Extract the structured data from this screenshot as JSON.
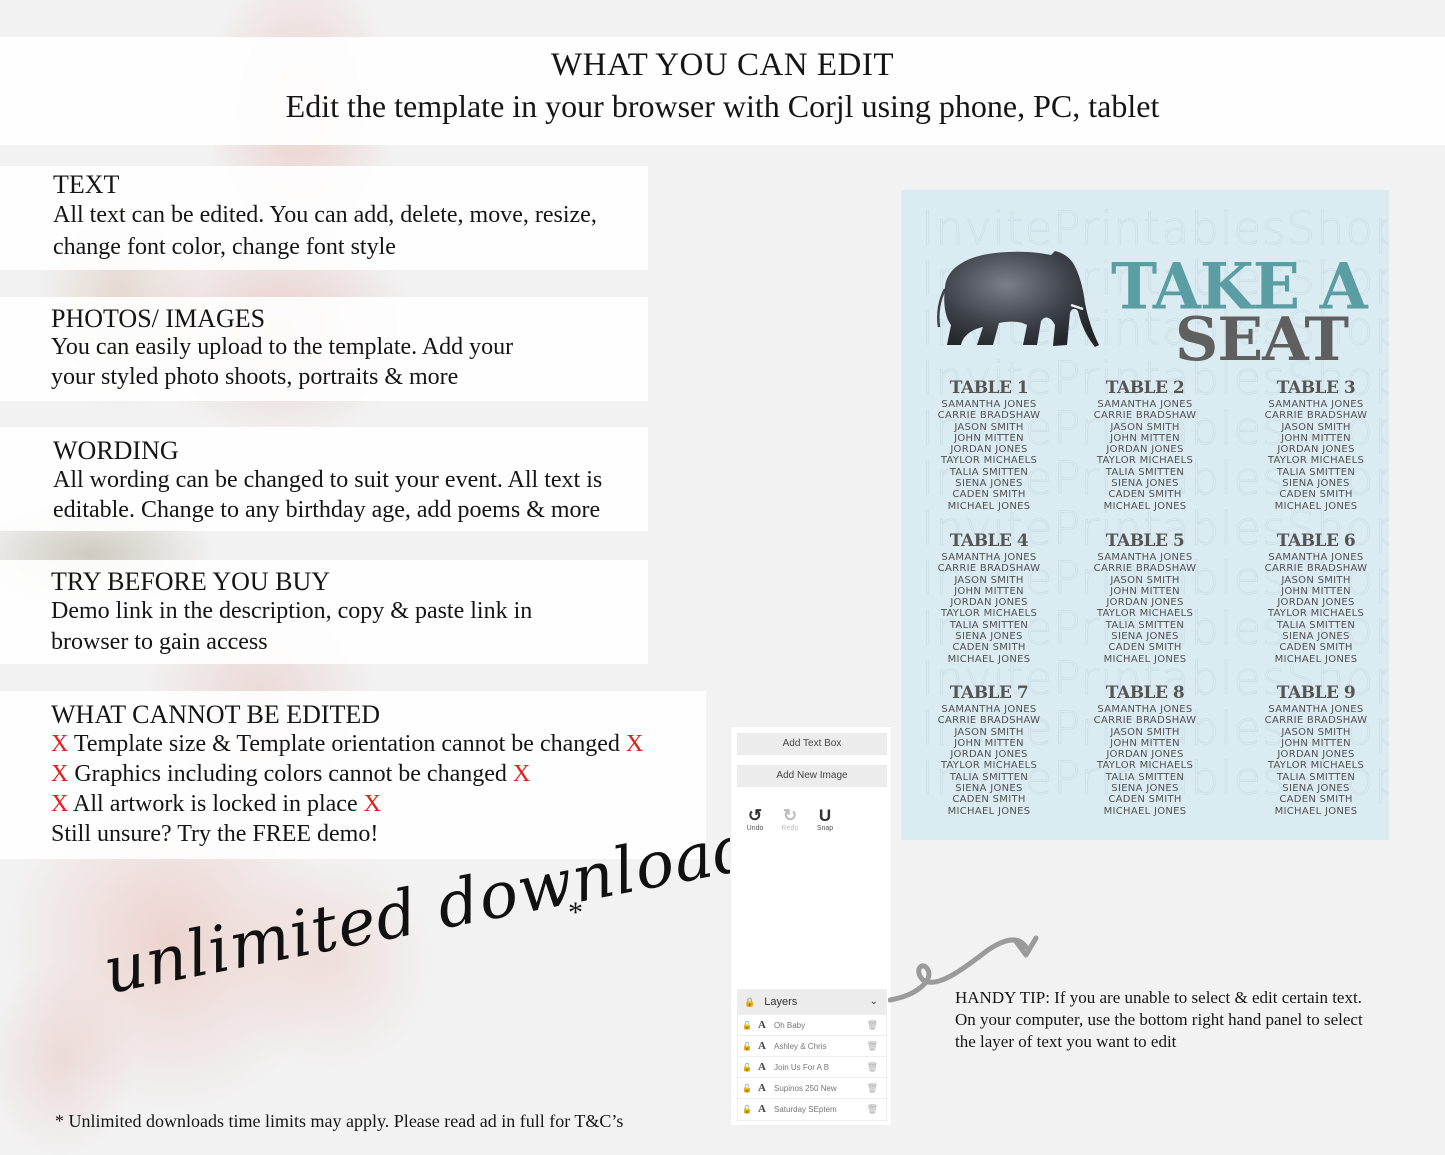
{
  "header": {
    "title": "WHAT YOU CAN EDIT",
    "subtitle": "Edit the template in your browser with Corjl using phone, PC, tablet"
  },
  "sections": {
    "text": {
      "title": "TEXT",
      "lines": [
        "All text can be edited. You can add, delete, move, resize,",
        "change font color, change font style"
      ]
    },
    "photos": {
      "title": "PHOTOS/ IMAGES",
      "lines": [
        "You can easily upload to the template. Add your",
        "your styled photo shoots, portraits & more"
      ]
    },
    "wording": {
      "title": "WORDING",
      "lines": [
        "All wording can be changed to suit your event. All text is",
        "editable. Change to any birthday age, add poems & more"
      ]
    },
    "try": {
      "title": "TRY BEFORE YOU BUY",
      "lines": [
        "Demo link in the description, copy & paste link in",
        "browser to gain access"
      ]
    },
    "cannot": {
      "title": "WHAT CANNOT BE EDITED",
      "x": "X",
      "items": [
        "Template size & Template orientation cannot be changed",
        "Graphics including colors cannot be changed",
        "All artwork is locked in place"
      ],
      "closing": "Still unsure? Try the FREE demo!"
    }
  },
  "promo": {
    "script": "unlimited downloads",
    "asterisk": "*",
    "footnote": "* Unlimited downloads time limits may apply. Please read ad in full for T&C’s"
  },
  "editor": {
    "add_text_box": "Add Text Box",
    "add_new_image": "Add New Image",
    "tools": [
      {
        "icon": "undo-icon",
        "glyph": "↺",
        "label": "Undo"
      },
      {
        "icon": "redo-icon",
        "glyph": "↻",
        "label": "Redo"
      },
      {
        "icon": "magnet-icon",
        "glyph": "U",
        "label": "Snap"
      }
    ],
    "layers": {
      "title": "Layers",
      "items": [
        "Oh Baby",
        "Ashley & Chris",
        "Join Us For A B",
        "Supinos 250 New",
        "Saturday SEptem"
      ]
    }
  },
  "tip": {
    "lines": [
      "HANDY TIP: If you are unable to select & edit certain text.",
      "On your computer, use the bottom right hand panel to select",
      "the layer of text you want to edit"
    ]
  },
  "preview": {
    "watermark": "InvitePrintablesShop",
    "title_line1": "TAKE A",
    "title_line2": "SEAT",
    "colors": {
      "background": "#dbebf2",
      "accent": "#5a9ea3",
      "dark": "#5f5f5f"
    },
    "tables": [
      {
        "title": "TABLE 1",
        "guests": [
          "SAMANTHA JONES",
          "CARRIE BRADSHAW",
          "JASON SMITH",
          "JOHN MITTEN",
          "JORDAN JONES",
          "TAYLOR MICHAELS",
          "TALIA SMITTEN",
          "SIENA JONES",
          "CADEN SMITH",
          "MICHAEL JONES"
        ]
      },
      {
        "title": "TABLE 2",
        "guests": [
          "SAMANTHA JONES",
          "CARRIE BRADSHAW",
          "JASON SMITH",
          "JOHN MITTEN",
          "JORDAN JONES",
          "TAYLOR MICHAELS",
          "TALIA SMITTEN",
          "SIENA JONES",
          "CADEN SMITH",
          "MICHAEL JONES"
        ]
      },
      {
        "title": "TABLE 3",
        "guests": [
          "SAMANTHA JONES",
          "CARRIE BRADSHAW",
          "JASON SMITH",
          "JOHN MITTEN",
          "JORDAN JONES",
          "TAYLOR MICHAELS",
          "TALIA SMITTEN",
          "SIENA JONES",
          "CADEN SMITH",
          "MICHAEL JONES"
        ]
      },
      {
        "title": "TABLE 4",
        "guests": [
          "SAMANTHA JONES",
          "CARRIE BRADSHAW",
          "JASON SMITH",
          "JOHN MITTEN",
          "JORDAN JONES",
          "TAYLOR MICHAELS",
          "TALIA SMITTEN",
          "SIENA JONES",
          "CADEN SMITH",
          "MICHAEL JONES"
        ]
      },
      {
        "title": "TABLE 5",
        "guests": [
          "SAMANTHA JONES",
          "CARRIE BRADSHAW",
          "JASON SMITH",
          "JOHN MITTEN",
          "JORDAN JONES",
          "TAYLOR MICHAELS",
          "TALIA SMITTEN",
          "SIENA JONES",
          "CADEN SMITH",
          "MICHAEL JONES"
        ]
      },
      {
        "title": "TABLE 6",
        "guests": [
          "SAMANTHA JONES",
          "CARRIE BRADSHAW",
          "JASON SMITH",
          "JOHN MITTEN",
          "JORDAN JONES",
          "TAYLOR MICHAELS",
          "TALIA SMITTEN",
          "SIENA JONES",
          "CADEN SMITH",
          "MICHAEL JONES"
        ]
      },
      {
        "title": "TABLE 7",
        "guests": [
          "SAMANTHA JONES",
          "CARRIE BRADSHAW",
          "JASON SMITH",
          "JOHN MITTEN",
          "JORDAN JONES",
          "TAYLOR MICHAELS",
          "TALIA SMITTEN",
          "SIENA JONES",
          "CADEN SMITH",
          "MICHAEL JONES"
        ]
      },
      {
        "title": "TABLE 8",
        "guests": [
          "SAMANTHA JONES",
          "CARRIE BRADSHAW",
          "JASON SMITH",
          "JOHN MITTEN",
          "JORDAN JONES",
          "TAYLOR MICHAELS",
          "TALIA SMITTEN",
          "SIENA JONES",
          "CADEN SMITH",
          "MICHAEL JONES"
        ]
      },
      {
        "title": "TABLE 9",
        "guests": [
          "SAMANTHA JONES",
          "CARRIE BRADSHAW",
          "JASON SMITH",
          "JOHN MITTEN",
          "JORDAN JONES",
          "TAYLOR MICHAELS",
          "TALIA SMITTEN",
          "SIENA JONES",
          "CADEN SMITH",
          "MICHAEL JONES"
        ]
      }
    ]
  }
}
